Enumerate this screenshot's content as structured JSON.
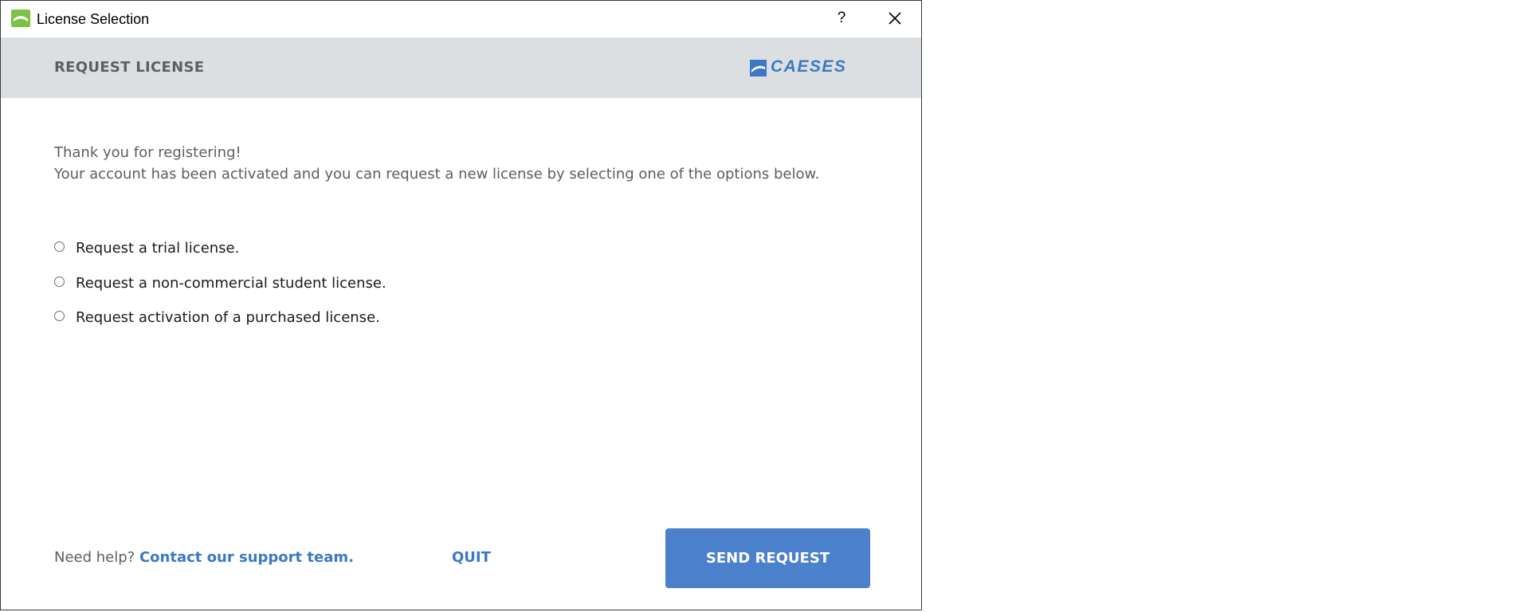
{
  "window": {
    "title": "License Selection",
    "help_label": "?",
    "icon": "app-icon",
    "close_icon": "close-icon"
  },
  "header": {
    "title": "REQUEST LICENSE",
    "brand": "CAESES"
  },
  "intro": {
    "line1": "Thank you for registering!",
    "line2": "Your account has been activated and you can request a new license by selecting one of the options below."
  },
  "options": [
    {
      "label": "Request a trial license.",
      "selected": false
    },
    {
      "label": "Request a non-commercial student license.",
      "selected": false
    },
    {
      "label": "Request activation of a purchased license.",
      "selected": false
    }
  ],
  "footer": {
    "help_prefix": "Need help?",
    "support_link": "Contact our support team.",
    "quit_label": "QUIT",
    "send_label": "SEND REQUEST"
  },
  "colors": {
    "accent": "#3c78c4",
    "button": "#4a80cc",
    "header_band": "#dcdfe2",
    "app_icon": "#7cc244"
  }
}
